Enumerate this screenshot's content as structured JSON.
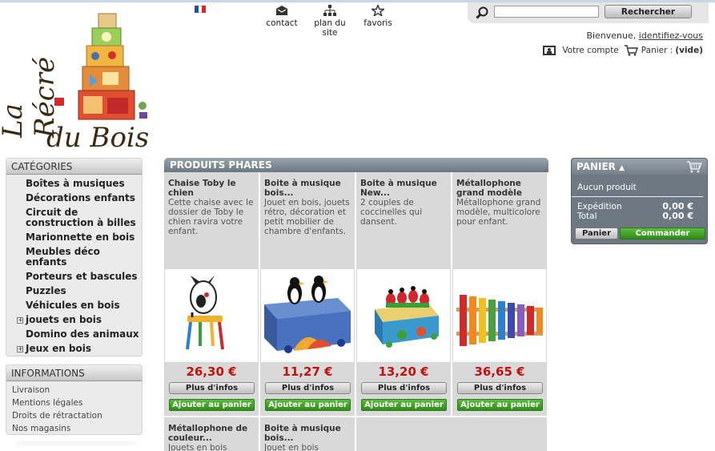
{
  "logo": {
    "line1": "La Récré",
    "line2": "du Bois"
  },
  "topnav": [
    {
      "label": "contact",
      "icon": "envelope-icon"
    },
    {
      "label": "plan du site",
      "icon": "sitemap-icon"
    },
    {
      "label": "favoris",
      "icon": "star-icon"
    }
  ],
  "search": {
    "placeholder": "",
    "button": "Rechercher"
  },
  "user": {
    "welcome": "Bienvenue,",
    "login_link": "identifiez-vous",
    "account": "Votre compte",
    "cart_label": "Panier :",
    "cart_state": "(vide)"
  },
  "categories": {
    "title": "CATÉGORIES",
    "items": [
      {
        "label": "Boîtes à musiques",
        "expandable": false
      },
      {
        "label": "Décorations enfants",
        "expandable": false
      },
      {
        "label": "Circuit de construction à billes",
        "expandable": false
      },
      {
        "label": "Marionnette en bois",
        "expandable": false
      },
      {
        "label": "Meubles déco enfants",
        "expandable": false
      },
      {
        "label": "Porteurs et bascules",
        "expandable": false
      },
      {
        "label": "Puzzles",
        "expandable": false
      },
      {
        "label": "Véhicules en bois",
        "expandable": false
      },
      {
        "label": "jouets en bois",
        "expandable": true
      },
      {
        "label": "Domino des animaux",
        "expandable": false
      },
      {
        "label": "Jeux en bois",
        "expandable": true
      }
    ]
  },
  "informations": {
    "title": "INFORMATIONS",
    "items": [
      "Livraison",
      "Mentions légales",
      "Droits de rétractation",
      "Nos magasins"
    ]
  },
  "products": {
    "title": "PRODUITS PHARES",
    "more_label": "Plus d'infos",
    "add_label": "Ajouter au panier",
    "items": [
      {
        "title": "Chaise Toby le chien",
        "desc": "Cette chaise avec le dossier de Toby le chien ravira votre enfant.",
        "price": "26,30 €",
        "image": "chair-dog-image"
      },
      {
        "title": "Boite à musique bois...",
        "desc": "Jouet en bois, jouets rétro, décoration et petit mobilier de chambre d'enfants.",
        "price": "11,27 €",
        "image": "music-box-penguins-image"
      },
      {
        "title": "Boite à musique New...",
        "desc": "2 couples de coccinelles qui dansent.",
        "price": "13,20 €",
        "image": "music-box-ladybugs-image"
      },
      {
        "title": "Métallophone grand modèle",
        "desc": "Métallophone grand modèle, multicolore pour enfant.",
        "price": "36,65 €",
        "image": "xylophone-image"
      },
      {
        "title": "Métallophone de couleur...",
        "desc": "Jouets en bois",
        "price": "",
        "image": ""
      },
      {
        "title": "Boite à musique bois...",
        "desc": "Jouet en bois",
        "price": "",
        "image": ""
      }
    ]
  },
  "cart": {
    "title": "PANIER",
    "empty": "Aucun produit",
    "shipping_label": "Expédition",
    "shipping_value": "0,00 €",
    "total_label": "Total",
    "total_value": "0,00 €",
    "cart_button": "Panier",
    "order_button": "Commander"
  },
  "colors": {
    "price": "#c3110b",
    "add_button": "#3a9a22",
    "header_dark": "#6b7680"
  }
}
